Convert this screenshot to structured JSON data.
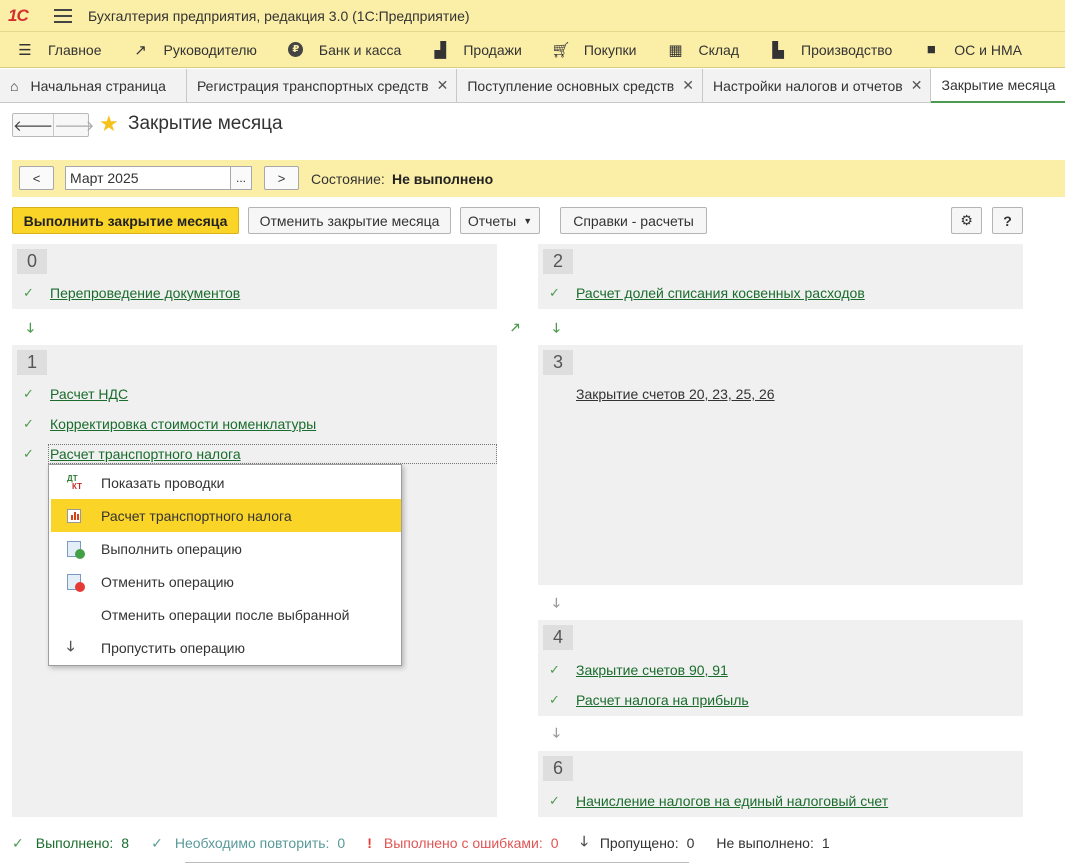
{
  "app": {
    "title": "Бухгалтерия предприятия, редакция 3.0  (1С:Предприятие)",
    "logo_text": "1С"
  },
  "sections": [
    {
      "label": "Главное",
      "icon": "menu-icon"
    },
    {
      "label": "Руководителю",
      "icon": "trend-icon"
    },
    {
      "label": "Банк и касса",
      "icon": "coin-icon"
    },
    {
      "label": "Продажи",
      "icon": "bag-icon"
    },
    {
      "label": "Покупки",
      "icon": "cart-icon"
    },
    {
      "label": "Склад",
      "icon": "grid-icon"
    },
    {
      "label": "Производство",
      "icon": "factory-icon"
    },
    {
      "label": "ОС и НМА",
      "icon": "truck-icon"
    }
  ],
  "tabs": [
    {
      "label": "Начальная страница"
    },
    {
      "label": "Регистрация транспортных средств"
    },
    {
      "label": "Поступление основных средств"
    },
    {
      "label": "Настройки налогов и отчетов"
    },
    {
      "label": "Закрытие месяца"
    }
  ],
  "page": {
    "title": "Закрытие месяца"
  },
  "period": {
    "prev_label": "<",
    "next_label": ">",
    "value": "Март 2025",
    "choose_label": "...",
    "state_label": "Состояние:",
    "state_value": "Не выполнено"
  },
  "commands": {
    "run": "Выполнить закрытие месяца",
    "cancel": "Отменить закрытие месяца",
    "reports": "Отчеты",
    "refs": "Справки - расчеты",
    "help": "?"
  },
  "stages": {
    "s0": {
      "number": "0",
      "ops": [
        "Перепроведение документов"
      ]
    },
    "s1": {
      "number": "1",
      "ops": [
        "Расчет НДС",
        "Корректировка стоимости номенклатуры",
        "Расчет транспортного налога"
      ]
    },
    "s2": {
      "number": "2",
      "ops": [
        "Расчет долей списания косвенных расходов"
      ]
    },
    "s3": {
      "number": "3",
      "ops": [
        "Закрытие счетов 20, 23, 25, 26"
      ]
    },
    "s4": {
      "number": "4",
      "ops": [
        "Закрытие счетов 90, 91",
        "Расчет налога на прибыль"
      ]
    },
    "s6": {
      "number": "6",
      "ops": [
        "Начисление налогов на единый налоговый счет"
      ]
    }
  },
  "context_menu": [
    {
      "label": "Показать проводки",
      "icon": "dt-kt-icon"
    },
    {
      "label": "Расчет транспортного налога",
      "icon": "report-icon",
      "highlighted": true
    },
    {
      "label": "Выполнить операцию",
      "icon": "run-operation-icon"
    },
    {
      "label": "Отменить операцию",
      "icon": "cancel-operation-icon"
    },
    {
      "label": "Отменить операции после выбранной",
      "icon": ""
    },
    {
      "label": "Пропустить операцию",
      "icon": "arrow-down-icon"
    }
  ],
  "status": {
    "done_label": "Выполнено:",
    "done_count": "8",
    "repeat_label": "Необходимо повторить:",
    "repeat_count": "0",
    "errors_label": "Выполнено с ошибками:",
    "errors_count": "0",
    "skipped_label": "Пропущено:",
    "skipped_count": "0",
    "notdone_label": "Не выполнено:",
    "notdone_count": "1"
  },
  "colors": {
    "accent_yellow": "#fbd428",
    "header_yellow": "#fbeea7",
    "link_green": "#1a6c2d",
    "check_green": "#4c9a4f",
    "error_red": "#e05555",
    "repeat_teal": "#5a9a9a"
  }
}
